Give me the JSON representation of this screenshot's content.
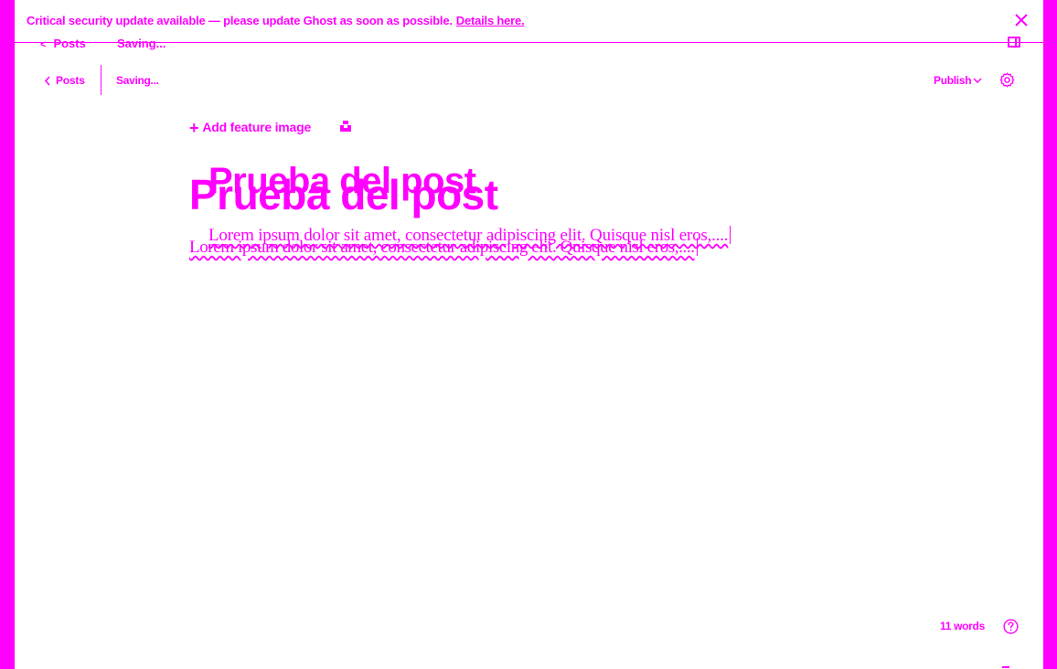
{
  "theme": {
    "accent": "#ff00ff",
    "background": "#ffffff"
  },
  "banner": {
    "message": "Critical security update available — please update Ghost as soon as possible.",
    "link_text": "Details here.",
    "close_icon": "close-icon"
  },
  "overlay_header": {
    "back_label": "Posts",
    "status": "Saving...",
    "sidebar_icon": "sidebar-toggle-icon"
  },
  "editor_header": {
    "back_label": "Posts",
    "status": "Saving...",
    "publish_label": "Publish",
    "settings_icon": "gear-icon"
  },
  "editor": {
    "feature_image_label": "Add feature image",
    "unsplash_icon": "unsplash-icon",
    "title": "Prueba del post",
    "title_echo": "Prueba del post",
    "body": "Lorem ipsum dolor sit amet, consectetur adipiscing elit. Quisque nisl eros,....",
    "body_echo": "Lorem ipsum dolor sit amet, consectetur adipiscing elit. Quisque nisl eros,...."
  },
  "footer": {
    "word_count": "11 words",
    "help_icon": "help-icon"
  }
}
